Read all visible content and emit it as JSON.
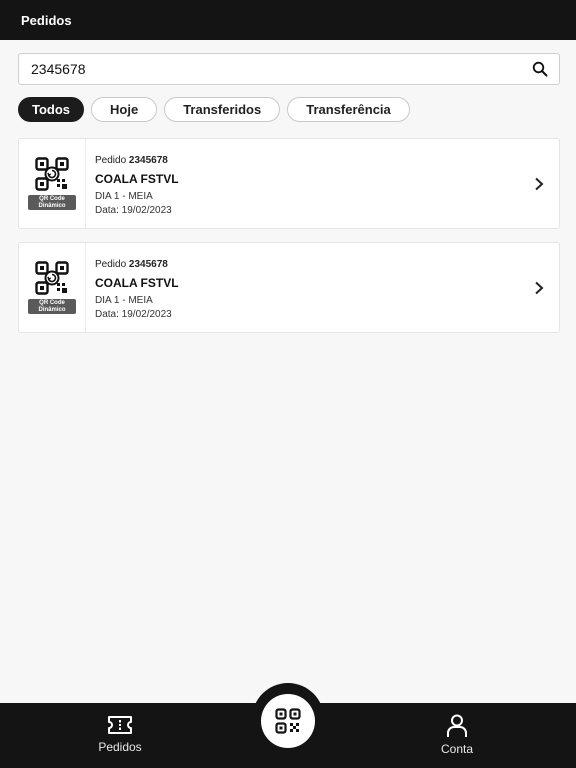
{
  "header": {
    "title": "Pedidos"
  },
  "search": {
    "value": "2345678",
    "icon": "search-icon"
  },
  "filters": [
    {
      "label": "Todos",
      "active": true
    },
    {
      "label": "Hoje",
      "active": false
    },
    {
      "label": "Transferidos",
      "active": false
    },
    {
      "label": "Transferência",
      "active": false
    }
  ],
  "orders": [
    {
      "badge_line1": "QR Code",
      "badge_line2": "Dinâmico",
      "order_label": "Pedido",
      "order_number": "2345678",
      "event": "COALA FSTVL",
      "ticket": "DIA 1 - MEIA",
      "date": "Data: 19/02/2023"
    },
    {
      "badge_line1": "QR Code",
      "badge_line2": "Dinâmico",
      "order_label": "Pedido",
      "order_number": "2345678",
      "event": "COALA FSTVL",
      "ticket": "DIA 1 - MEIA",
      "date": "Data: 19/02/2023"
    }
  ],
  "bottom_nav": {
    "left_label": "Pedidos",
    "right_label": "Conta",
    "center_icon": "qr-scan-icon"
  },
  "colors": {
    "dark": "#141414",
    "background": "#f7f7f7",
    "card": "#ffffff",
    "badge": "#5a5a5a"
  }
}
